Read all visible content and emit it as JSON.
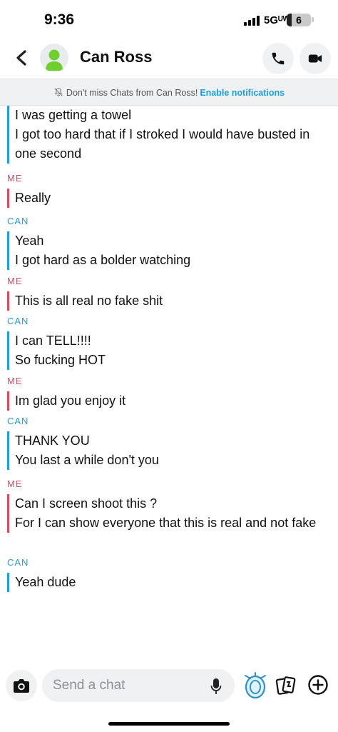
{
  "status_bar": {
    "time": "9:36",
    "network": "5Gᵁᵂ",
    "battery": "6"
  },
  "header": {
    "contact_name": "Can Ross"
  },
  "notification_banner": {
    "text": "Don't miss Chats from Can Ross!",
    "link": "Enable notifications"
  },
  "colors": {
    "me": "#e0465e",
    "can": "#1aa0e0",
    "header_bg": "#ffffff",
    "bar_bg": "#f0f1f3"
  },
  "messages": [
    {
      "sender": "",
      "role": "can",
      "lines": [
        "I was getting a towel",
        "I got too hard that if I stroked I would have busted in one second"
      ]
    },
    {
      "sender": "ME",
      "role": "me",
      "lines": [
        "Really"
      ]
    },
    {
      "sender": "CAN",
      "role": "can",
      "lines": [
        "Yeah",
        "I got hard as a bolder watching"
      ]
    },
    {
      "sender": "ME",
      "role": "me",
      "lines": [
        "This is all real no fake shit"
      ]
    },
    {
      "sender": "CAN",
      "role": "can",
      "lines": [
        "I can TELL!!!!",
        "So fucking HOT"
      ]
    },
    {
      "sender": "ME",
      "role": "me",
      "lines": [
        "Im glad you enjoy it"
      ]
    },
    {
      "sender": "CAN",
      "role": "can",
      "lines": [
        "THANK YOU",
        "You last a while don't you"
      ]
    },
    {
      "sender": "ME",
      "role": "me",
      "lines": [
        "Can I screen shoot this ?",
        "For I can show everyone that this is real and not fake"
      ]
    },
    {
      "sender": "CAN",
      "role": "can",
      "lines": [
        "Yeah dude"
      ]
    }
  ],
  "composer": {
    "placeholder": "Send a chat",
    "icons": [
      "camera-icon",
      "microphone-icon",
      "bitmoji-icon",
      "memories-cards-icon",
      "plus-icon"
    ]
  }
}
